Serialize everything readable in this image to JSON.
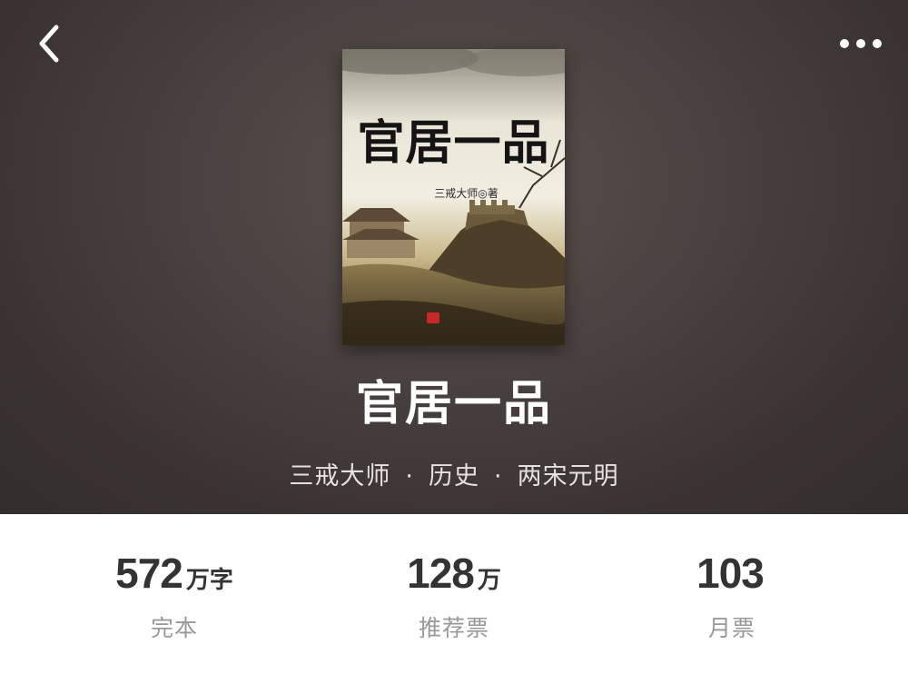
{
  "header": {
    "back_icon": "chevron-left-icon",
    "more_icon": "more-dots-icon"
  },
  "book": {
    "title": "官居一品",
    "cover": {
      "title": "官居一品",
      "author_line": "三戒大师◎著"
    },
    "meta": {
      "author": "三戒大师",
      "category": "历史",
      "subcategory": "两宋元明",
      "separator": "·"
    }
  },
  "stats": [
    {
      "value": "572",
      "unit": "万字",
      "label": "完本"
    },
    {
      "value": "128",
      "unit": "万",
      "label": "推荐票"
    },
    {
      "value": "103",
      "unit": "",
      "label": "月票"
    }
  ],
  "colors": {
    "header_bg": "#4a4240",
    "title_text": "#ffffff",
    "stat_value": "#333333",
    "stat_label": "#999999"
  }
}
